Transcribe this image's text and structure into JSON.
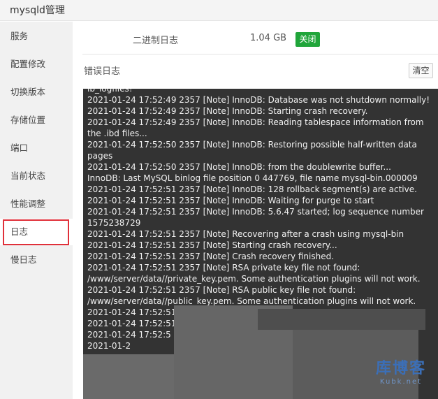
{
  "window": {
    "title": "mysqld管理"
  },
  "sidebar": {
    "items": [
      {
        "label": "服务"
      },
      {
        "label": "配置修改"
      },
      {
        "label": "切换版本"
      },
      {
        "label": "存储位置"
      },
      {
        "label": "端口"
      },
      {
        "label": "当前状态"
      },
      {
        "label": "性能调整"
      },
      {
        "label": "日志"
      },
      {
        "label": "慢日志"
      }
    ],
    "active_index": 7
  },
  "binlog": {
    "label": "二进制日志",
    "size": "1.04 GB",
    "toggle_label": "关闭",
    "toggle_color": "#20a53a"
  },
  "error_log": {
    "label": "错误日志",
    "clear_label": "清空",
    "lines": [
      "ib_logfiles!",
      "2021-01-24 17:52:49 2357 [Note] InnoDB: Database was not shutdown normally!",
      "2021-01-24 17:52:49 2357 [Note] InnoDB: Starting crash recovery.",
      "2021-01-24 17:52:49 2357 [Note] InnoDB: Reading tablespace information from the .ibd files...",
      "2021-01-24 17:52:50 2357 [Note] InnoDB: Restoring possible half-written data pages",
      "2021-01-24 17:52:50 2357 [Note] InnoDB: from the doublewrite buffer...",
      "InnoDB: Last MySQL binlog file position 0 447769, file name mysql-bin.000009",
      "2021-01-24 17:52:51 2357 [Note] InnoDB: 128 rollback segment(s) are active.",
      "2021-01-24 17:52:51 2357 [Note] InnoDB: Waiting for purge to start",
      "2021-01-24 17:52:51 2357 [Note] InnoDB: 5.6.47 started; log sequence number 1575238729",
      "2021-01-24 17:52:51 2357 [Note] Recovering after a crash using mysql-bin",
      "2021-01-24 17:52:51 2357 [Note] Starting crash recovery...",
      "2021-01-24 17:52:51 2357 [Note] Crash recovery finished.",
      "2021-01-24 17:52:51 2357 [Note] RSA private key file not found: /www/server/data//private_key.pem. Some authentication plugins will not work.",
      "2021-01-24 17:52:51 2357 [Note] RSA public key file not found: /www/server/data//public_key.pem. Some authentication plugins will not work.",
      "2021-01-24 17:52:51",
      "2021-01-24 17:52:51",
      "2021-01-24 17:52:5",
      "2021-01-2"
    ]
  },
  "watermark": {
    "main": "库博客",
    "sub": "Kubk.net"
  }
}
